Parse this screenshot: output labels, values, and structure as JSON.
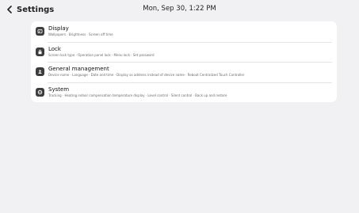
{
  "header": {
    "title": "Settings",
    "datetime": "Mon, Sep 30, 1:22 PM",
    "back_icon": "chevron-left-icon"
  },
  "settings": {
    "items": [
      {
        "title": "Display",
        "subtitle": "Wallpapers  ·  Brightness  ·  Screen off time",
        "icon": "display-icon"
      },
      {
        "title": "Lock",
        "subtitle": "Screen lock type  ·  Operation panel lock  ·  Menu lock  ·  Set password",
        "icon": "lock-icon"
      },
      {
        "title": "General management",
        "subtitle": "Device name  ·  Language  ·  Date and time  ·  Display as address instead of device name  ·  Reboot Centralized Touch Controller",
        "icon": "user-icon"
      },
      {
        "title": "System",
        "subtitle": "Tracking  ·  Heating indoor compensation temperature display  ·  Level control  ·  Silent control  ·  Back up and restore",
        "icon": "gear-icon"
      }
    ]
  },
  "colors": {
    "background": "#f1f1f3",
    "card": "#ffffff",
    "icon_tile": "#3d3d40"
  }
}
